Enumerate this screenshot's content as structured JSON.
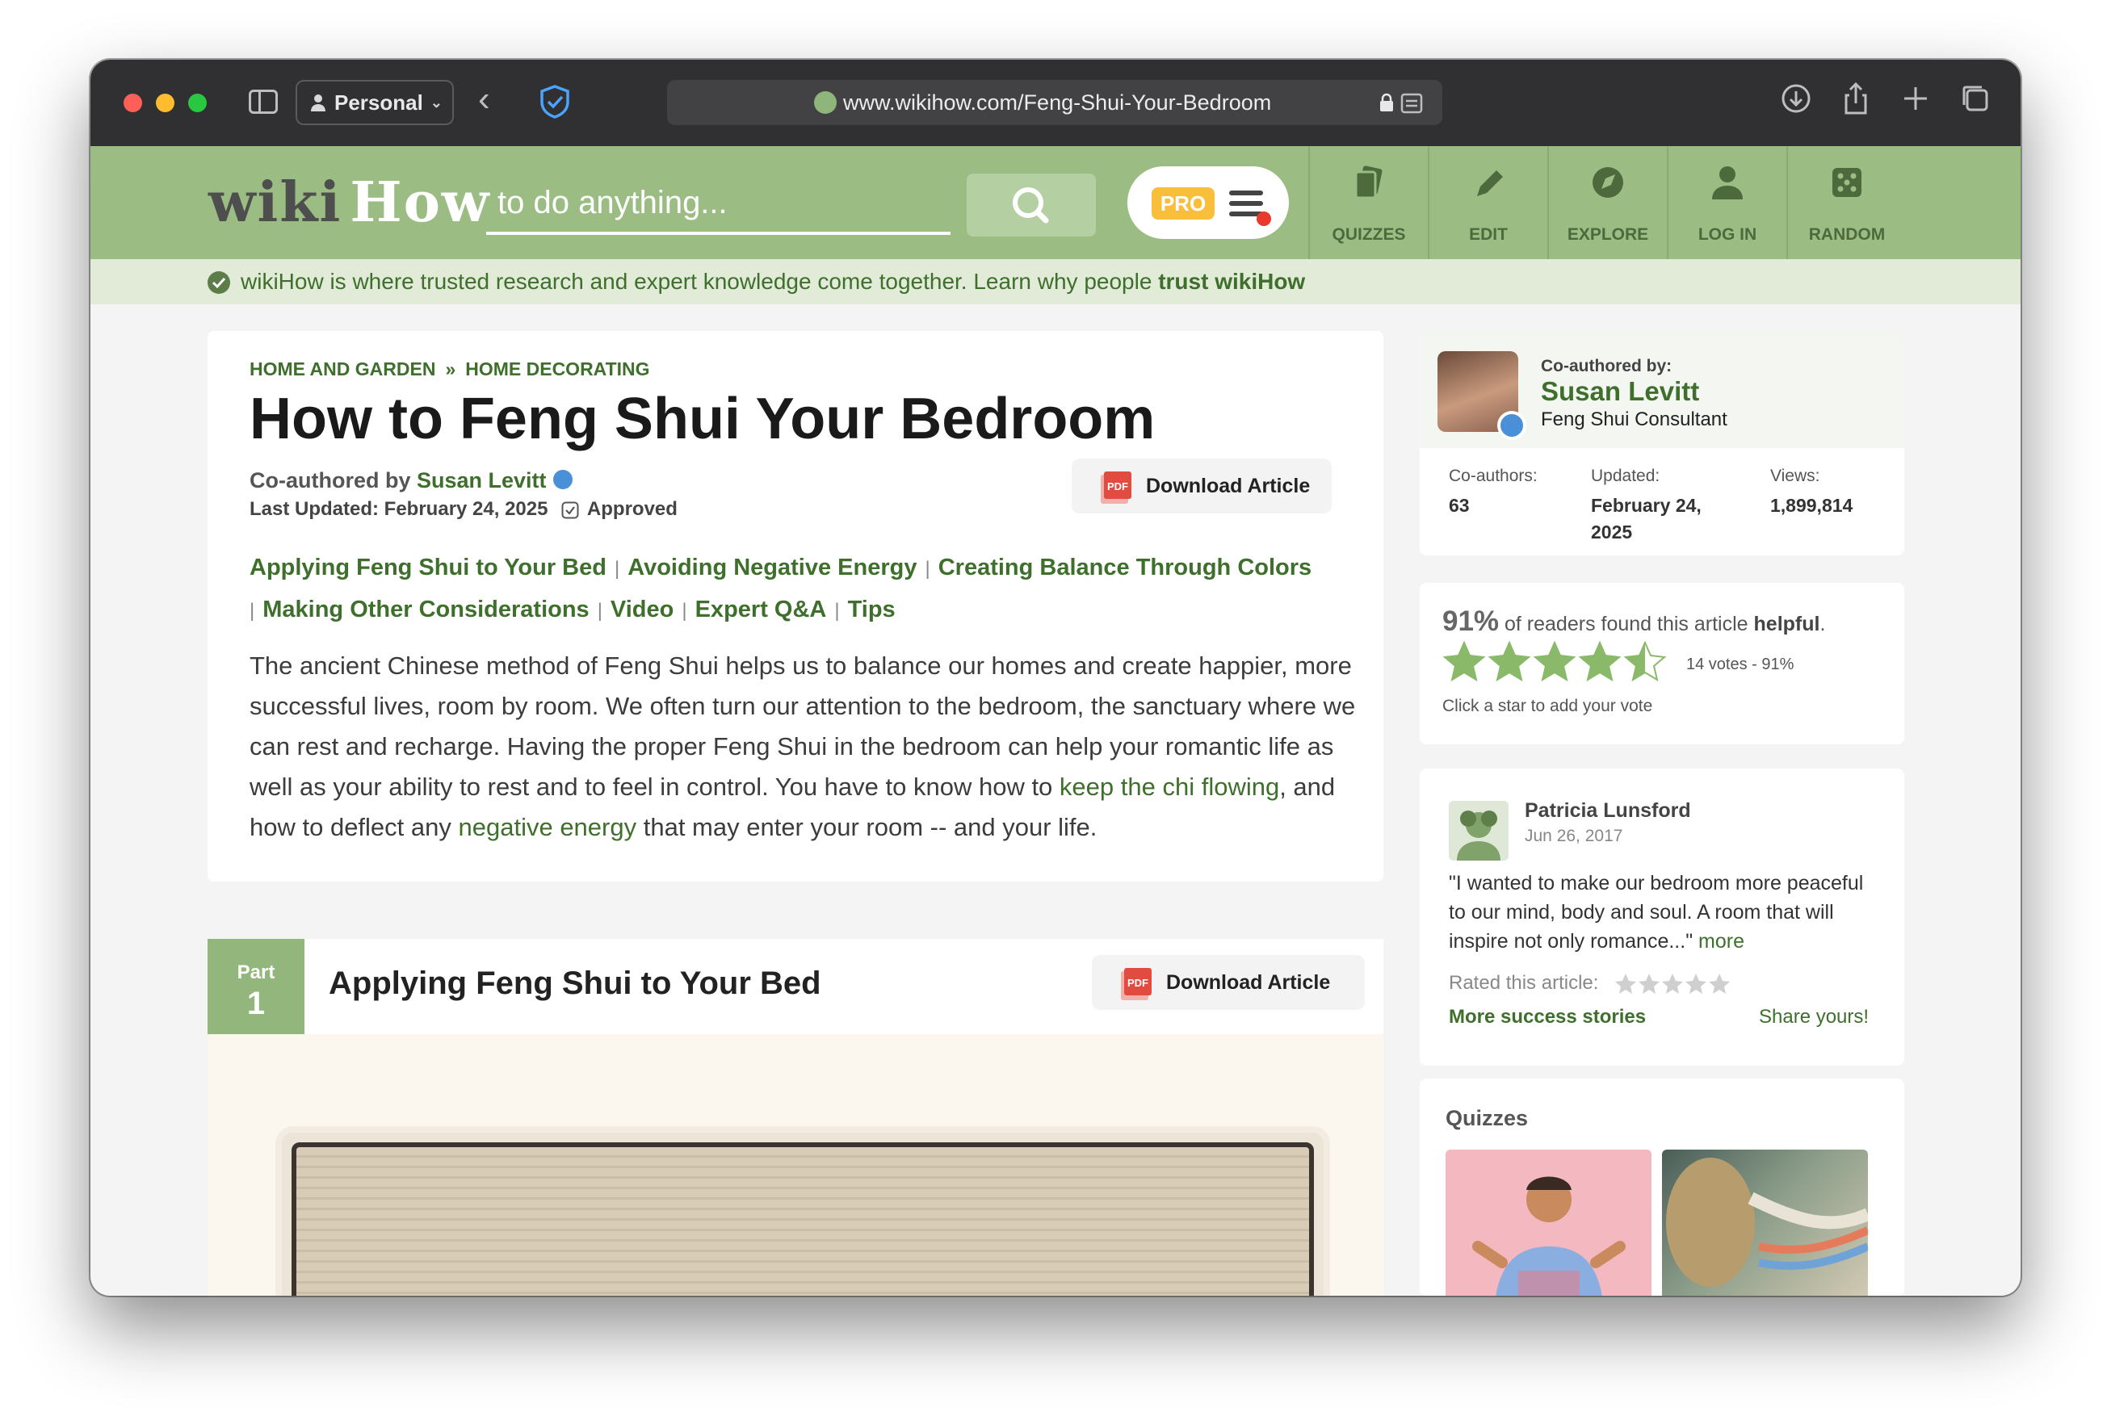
{
  "browser": {
    "profile": "Personal",
    "url": "www.wikihow.com/Feng-Shui-Your-Bedroom"
  },
  "header": {
    "logo_wiki": "wiki",
    "logo_how": "How",
    "search_placeholder": "to do anything...",
    "pro_label": "PRO",
    "nav": [
      {
        "label": "QUIZZES",
        "icon": "quizzes-icon"
      },
      {
        "label": "EDIT",
        "icon": "pencil-icon"
      },
      {
        "label": "EXPLORE",
        "icon": "compass-icon"
      },
      {
        "label": "LOG IN",
        "icon": "user-icon"
      },
      {
        "label": "RANDOM",
        "icon": "dice-icon"
      }
    ]
  },
  "trust_bar": {
    "text": "wikiHow is where trusted research and expert knowledge come together. Learn why people ",
    "link": "trust wikiHow"
  },
  "article": {
    "breadcrumbs": [
      "HOME AND GARDEN",
      "HOME DECORATING"
    ],
    "breadcrumb_sep": "»",
    "title": "How to Feng Shui Your Bedroom",
    "coauthored_prefix": "Co-authored by ",
    "author": "Susan Levitt",
    "last_updated": "Last Updated: February 24, 2025",
    "approved": "Approved",
    "download_label": "Download Article",
    "toc": [
      "Applying Feng Shui to Your Bed",
      "Avoiding Negative Energy",
      "Creating Balance Through Colors",
      "Making Other Considerations",
      "Video",
      "Expert Q&A",
      "Tips"
    ],
    "intro_1": "The ancient Chinese method of Feng Shui helps us to balance our homes and create happier, more successful lives, room by room. We often turn our attention to the bedroom, the sanctuary where we can rest and recharge. Having the proper Feng Shui in the bedroom can help your romantic life as well as your ability to rest and to feel in control. You have to know how to ",
    "intro_link_1": "keep the chi flowing",
    "intro_2": ", and how to deflect any ",
    "intro_link_2": "negative energy",
    "intro_3": " that may enter your room -- and your life."
  },
  "part": {
    "label": "Part",
    "number": "1",
    "title": "Applying Feng Shui to Your Bed",
    "download_label": "Download Article"
  },
  "sidebar": {
    "coauthor_label": "Co-authored by:",
    "name": "Susan Levitt",
    "role": "Feng Shui Consultant",
    "coauthors_label": "Co-authors:",
    "coauthors": "63",
    "updated_label": "Updated:",
    "updated_line1": "February 24,",
    "updated_line2": "2025",
    "views_label": "Views:",
    "views": "1,899,814",
    "helpful_pct": "91%",
    "helpful_mid": " of readers found this article ",
    "helpful_word": "helpful",
    "helpful_end": ".",
    "rating": 4.5,
    "votes": "14 votes - 91%",
    "click_hint": "Click a star to add your vote",
    "review_name": "Patricia Lunsford",
    "review_date": "Jun 26, 2017",
    "review_text": "\"I wanted to make our bedroom more peaceful to our mind, body and soul. A room that will inspire not only romance...\"",
    "review_more": "more",
    "rated_label": "Rated this article:",
    "more_stories": "More success stories",
    "share": "Share yours!",
    "quizzes_title": "Quizzes"
  },
  "colors": {
    "brand_green": "#9bbd83",
    "link_green": "#3f6f2c",
    "star_green": "#8ab96a",
    "pro_yellow": "#f9be3a"
  }
}
